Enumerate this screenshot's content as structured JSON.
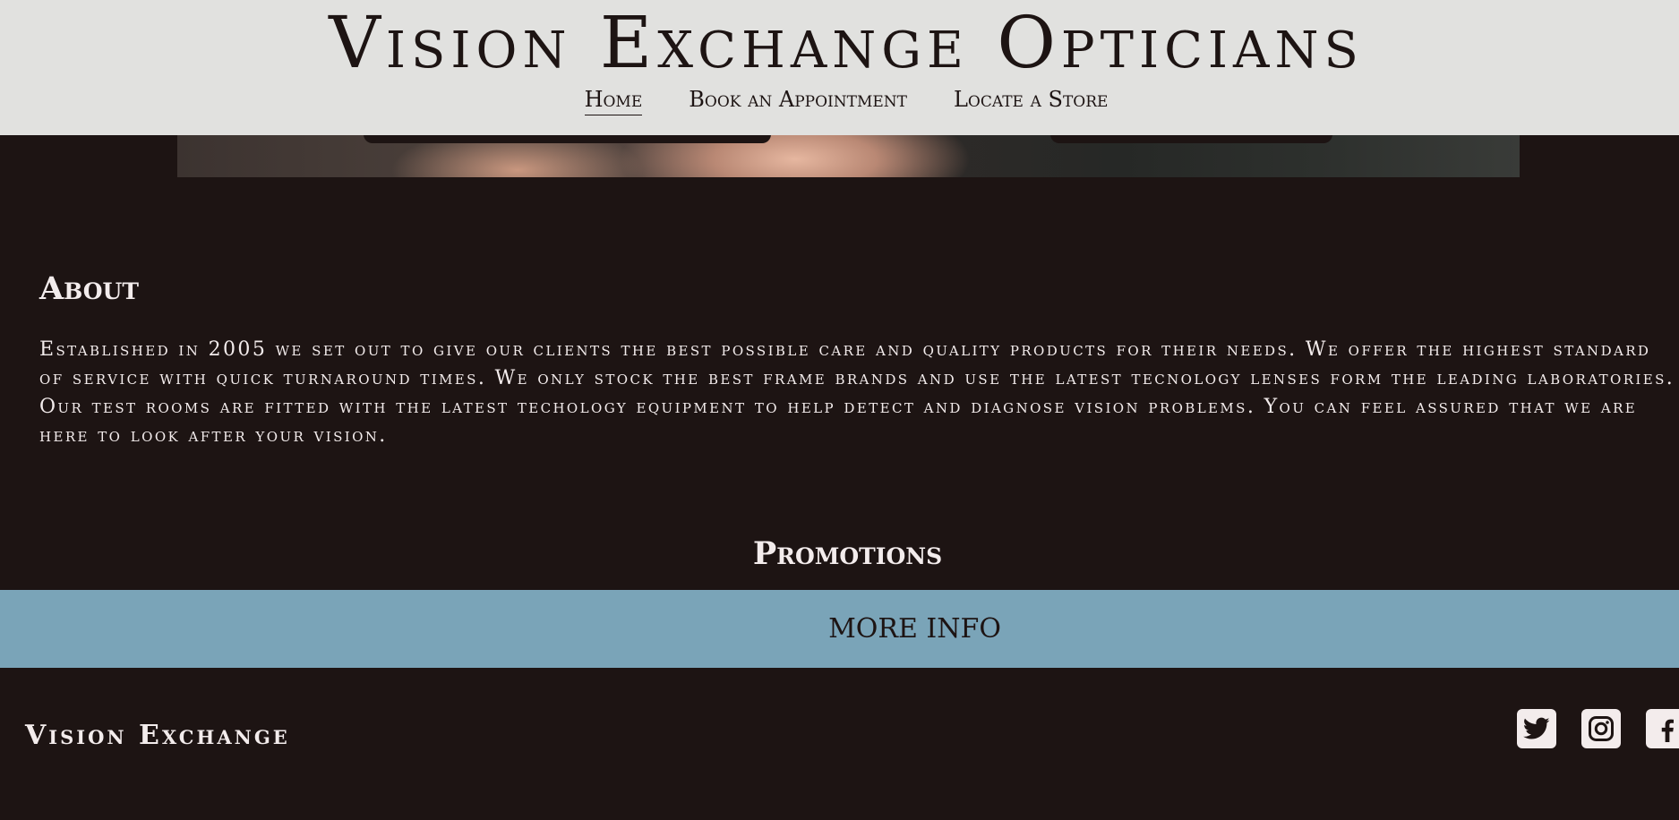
{
  "header": {
    "site_title": "Vision Exchange Opticians",
    "nav": [
      {
        "label": "Home",
        "active": true
      },
      {
        "label": "Book an Appointment",
        "active": false
      },
      {
        "label": "Locate a Store",
        "active": false
      }
    ]
  },
  "about": {
    "heading": "About",
    "text": "Established in 2005 we set out to give our clients the best possible care and quality products for their needs. We offer the highest standard of service with quick turnaround times. We only stock the best frame brands and use the latest tecnology lenses form the leading laboratories. Our test rooms are fitted with the latest techology equipment to help detect and diagnose vision problems. You can feel assured that we are here to look after your vision."
  },
  "promotions": {
    "heading": "Promotions",
    "button_label": "MORE INFO"
  },
  "footer": {
    "brand": "Vision Exchange",
    "social_icons": [
      "twitter-icon",
      "instagram-icon",
      "facebook-icon"
    ]
  },
  "colors": {
    "background": "#1d1413",
    "header": "#e1e1df",
    "accent": "#7aa4b8",
    "text_light": "#f3ecec"
  }
}
